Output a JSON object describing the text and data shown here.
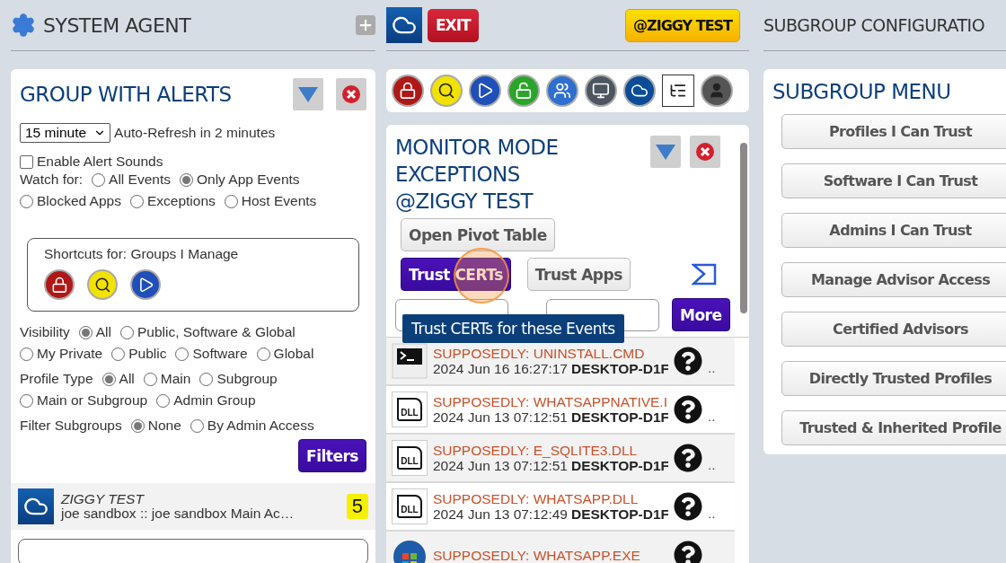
{
  "left_header": {
    "title": "SYSTEM AGENT"
  },
  "middle_header": {
    "exit_button": "EXIT",
    "profile_button": "@ZIGGY TEST"
  },
  "right_header": {
    "title": "SUBGROUP CONFIGURATIO"
  },
  "alerts_panel": {
    "title": "GROUP WITH ALERTS",
    "refresh_select": "15 minute",
    "refresh_note": "Auto-Refresh in 2 minutes",
    "sound_checkbox": {
      "label": "Enable Alert Sounds",
      "checked": false
    },
    "watch_group": {
      "label": "Watch for:",
      "options": [
        {
          "label": "All Events",
          "selected": false
        },
        {
          "label": "Only App Events",
          "selected": true
        },
        {
          "label": "Blocked Apps",
          "selected": false
        },
        {
          "label": "Exceptions",
          "selected": false
        },
        {
          "label": "Host Events",
          "selected": false
        }
      ]
    },
    "shortcuts": {
      "title": "Shortcuts for: Groups I Manage",
      "icons": [
        {
          "kind": "lock"
        },
        {
          "kind": "search"
        },
        {
          "kind": "play"
        }
      ]
    },
    "filter_groups": [
      {
        "label": "Visibility",
        "options": [
          {
            "label": "All",
            "selected": true
          },
          {
            "label": "Public, Software & Global",
            "selected": false
          },
          {
            "label": "My Private",
            "selected": false
          },
          {
            "label": "Public",
            "selected": false
          },
          {
            "label": "Software",
            "selected": false
          },
          {
            "label": "Global",
            "selected": false
          }
        ]
      },
      {
        "label": "Profile Type",
        "options": [
          {
            "label": "All",
            "selected": true
          },
          {
            "label": "Main",
            "selected": false
          },
          {
            "label": "Subgroup",
            "selected": false
          },
          {
            "label": "Main or Subgroup",
            "selected": false
          },
          {
            "label": "Admin Group",
            "selected": false
          }
        ]
      },
      {
        "label": "Filter Subgroups",
        "options": [
          {
            "label": "None",
            "selected": true
          },
          {
            "label": "By Admin Access",
            "selected": false
          }
        ]
      }
    ],
    "filters_button": "Filters",
    "groups": [
      {
        "name": "ZIGGY TEST",
        "detail": "joe sandbox :: joe sandbox Main Ac…",
        "count": "5"
      }
    ]
  },
  "toolbar": {
    "icons": [
      {
        "kind": "lock"
      },
      {
        "kind": "search"
      },
      {
        "kind": "play"
      },
      {
        "kind": "unlock"
      },
      {
        "kind": "users"
      },
      {
        "kind": "monitor"
      },
      {
        "kind": "cloud"
      },
      {
        "kind": "tree"
      },
      {
        "kind": "avatar"
      }
    ]
  },
  "monitor_panel": {
    "title": "MONITOR MODE EXCEPTIONS @ZIGGY TEST",
    "pivot_button": "Open Pivot Table",
    "trust_buttons": [
      {
        "label": "Trust CERTs",
        "selected": true
      },
      {
        "label": "Trust Apps",
        "selected": false
      }
    ],
    "more_button": "More",
    "tooltip": "Trust CERTs for these Events",
    "events": [
      {
        "kind": "terminal",
        "title": "SUPPOSEDLY: UNINSTALL.CMD",
        "time": "2024 Jun 16 16:27:17",
        "host": "DESKTOP-D1F",
        "more": ".."
      },
      {
        "kind": "dll",
        "icon_label": "DLL",
        "title": "SUPPOSEDLY: WHATSAPPNATIVE.I",
        "time": "2024 Jun 13 07:12:51",
        "host": "DESKTOP-D1F",
        "more": ".."
      },
      {
        "kind": "dll",
        "icon_label": "DLL",
        "title": "SUPPOSEDLY: E_SQLITE3.DLL",
        "time": "2024 Jun 13 07:12:51",
        "host": "DESKTOP-D1F",
        "more": ".."
      },
      {
        "kind": "dll",
        "icon_label": "DLL",
        "title": "SUPPOSEDLY: WHATSAPP.DLL",
        "time": "2024 Jun 13 07:12:49",
        "host": "DESKTOP-D1F",
        "more": ".."
      },
      {
        "kind": "windows",
        "title": "SUPPOSEDLY: WHATSAPP.EXE"
      }
    ]
  },
  "subgroup_menu": {
    "title": "SUBGROUP MENU",
    "items": [
      "Profiles I Can Trust",
      "Software I Can Trust",
      "Admins I Can Trust",
      "Manage Advisor Access",
      "Certified Advisors",
      "Directly Trusted Profiles",
      "Trusted & Inherited Profile"
    ]
  }
}
